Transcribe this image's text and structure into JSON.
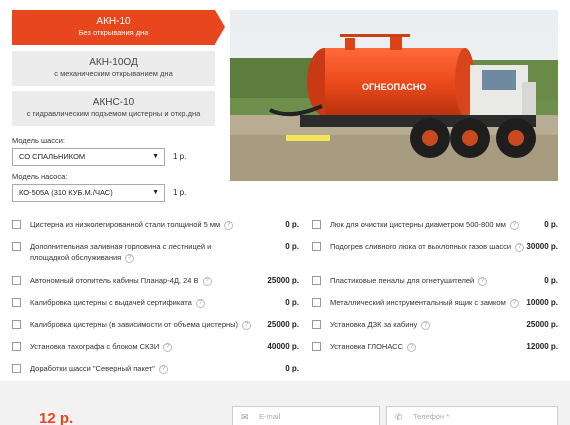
{
  "variants": [
    {
      "title": "АКН-10",
      "subtitle": "Без открывания дна",
      "active": true
    },
    {
      "title": "АКН-10ОД",
      "subtitle": "с механическим открыванием дна",
      "active": false
    },
    {
      "title": "АКНС-10",
      "subtitle": "с гидравлическим подъемом цистерны и откр.дна",
      "active": false
    }
  ],
  "photo": {
    "label": "ОГНЕОПАСНО"
  },
  "chassis": {
    "label": "Модель шасси:",
    "value": "СО СПАЛЬНИКОМ",
    "price": "1 р."
  },
  "pump": {
    "label": "Модель насоса:",
    "value": "КО-505А (310 КУБ.М./ЧАС)",
    "price": "1 р."
  },
  "options_left": [
    {
      "label": "Цистерна из низколегированной стали толщиной 5 мм",
      "price": "0 р."
    },
    {
      "label": "Дополнительная заливная горловина с лестницей и площадкой обслуживания",
      "price": "0 р."
    },
    {
      "label": "Автономный отопитель кабины Планар-4Д, 24 В",
      "price": "25000 р."
    },
    {
      "label": "Калибровка цистерны с выдачей сертификата",
      "price": "0 р."
    },
    {
      "label": "Калибровка цистерны (в зависимости от объема цистерны)",
      "price": "25000 р."
    },
    {
      "label": "Установка тахографа с блоком СКЗИ",
      "price": "40000 р."
    },
    {
      "label": "Доработки шасси \"Северный пакет\"",
      "price": "0 р."
    }
  ],
  "options_right": [
    {
      "label": "Люк для очистки цистерны диаметром 500-800 мм",
      "price": "0 р."
    },
    {
      "label": "Подогрев сливного люка от выхлопных газов шасси",
      "price": "30000 р."
    },
    {
      "label": "Пластиковые пеналы для огнетушителей",
      "price": "0 р."
    },
    {
      "label": "Металлический инструментальный ящик с замком",
      "price": "10000 р."
    },
    {
      "label": "Установка ДЗК за кабину",
      "price": "25000 р."
    },
    {
      "label": "Установка ГЛОНАСС",
      "price": "12000 р."
    }
  ],
  "footer": {
    "total": "12 р.",
    "email_placeholder": "E-mail",
    "phone_placeholder": "Телефон *"
  },
  "help_symbol": "?",
  "colors": {
    "accent": "#e8461c",
    "tab_bg": "#ececec",
    "footer_bg": "#f2f2f2"
  }
}
